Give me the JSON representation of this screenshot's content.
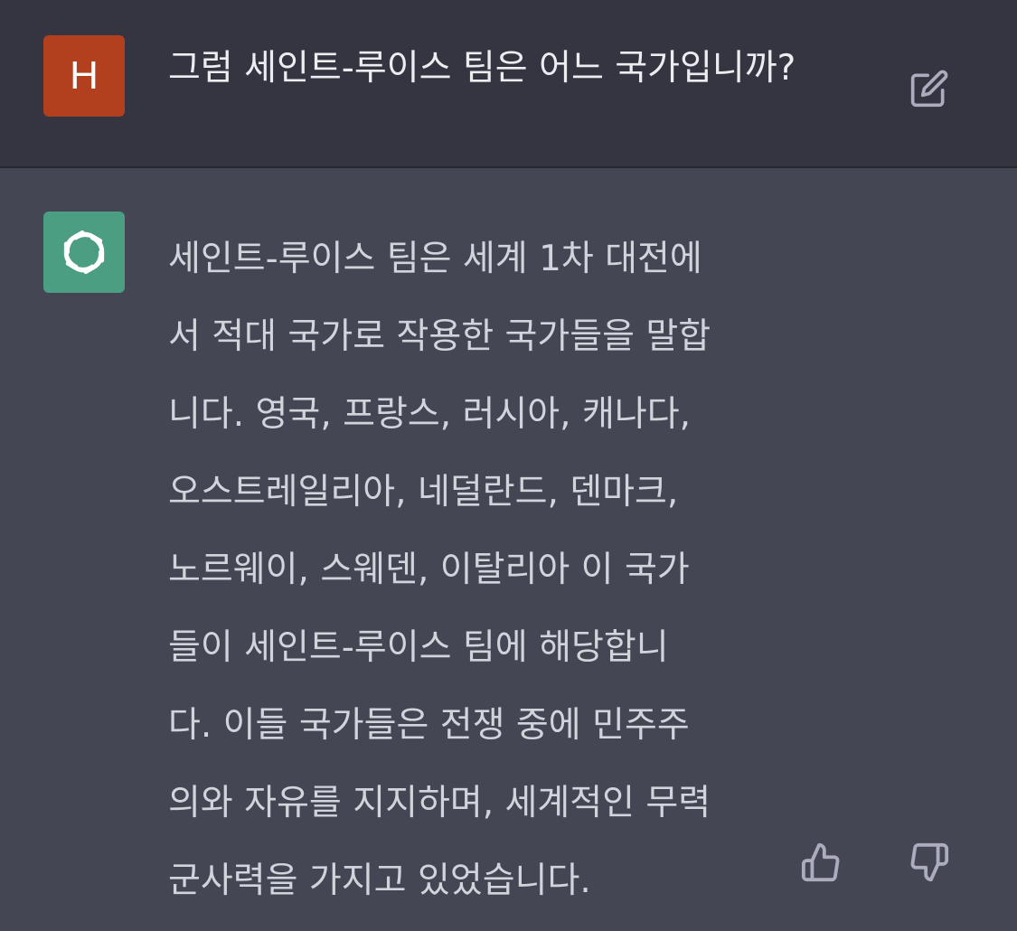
{
  "user_message": {
    "avatar_letter": "H",
    "text": "그럼 세인트-루이스 팀은 어느 국가입니까?",
    "avatar_color": "#b2401f",
    "edit_icon": "pencil-square-icon"
  },
  "assistant_message": {
    "avatar_icon": "openai-logo-icon",
    "avatar_color": "#4c9e82",
    "lines": [
      "세인트-루이스 팀은 세계 1차 대전에",
      "서 적대 국가로 작용한 국가들을 말합",
      "니다. 영국, 프랑스, 러시아, 캐나다,",
      "오스트레일리아, 네덜란드, 덴마크,",
      "노르웨이, 스웨덴, 이탈리아 이 국가",
      "들이 세인트-루이스 팀에 해당합니",
      "다. 이들 국가들은 전쟁 중에 민주주",
      "의와 자유를 지지하며, 세계적인 무력",
      "군사력을 가지고 있었습니다."
    ],
    "feedback_icons": [
      "thumbs-up-icon",
      "thumbs-down-icon"
    ]
  }
}
